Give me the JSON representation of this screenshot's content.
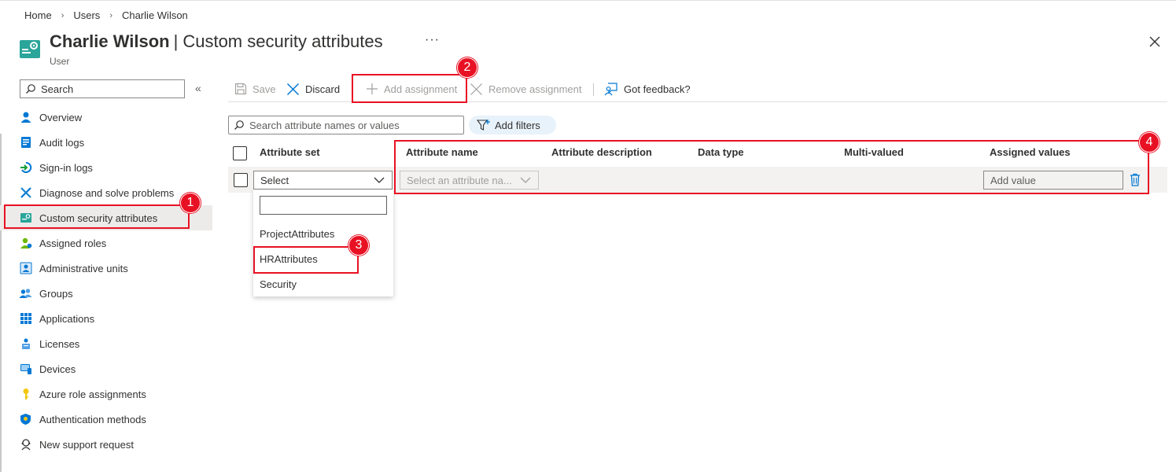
{
  "breadcrumb": [
    "Home",
    "Users",
    "Charlie Wilson"
  ],
  "header": {
    "title_name": "Charlie Wilson",
    "title_divider": "|",
    "title_section": "Custom security attributes",
    "more": "···",
    "subtitle": "User"
  },
  "sidebar": {
    "search_placeholder": "Search",
    "collapse": "«",
    "items": [
      {
        "label": "Overview",
        "icon": "user-icon"
      },
      {
        "label": "Audit logs",
        "icon": "audit-log-icon"
      },
      {
        "label": "Sign-in logs",
        "icon": "sign-in-icon"
      },
      {
        "label": "Diagnose and solve problems",
        "icon": "wrench-icon"
      },
      {
        "label": "Custom security attributes",
        "icon": "custom-attributes-icon",
        "selected": true
      },
      {
        "label": "Assigned roles",
        "icon": "assigned-roles-icon"
      },
      {
        "label": "Administrative units",
        "icon": "admin-units-icon"
      },
      {
        "label": "Groups",
        "icon": "groups-icon"
      },
      {
        "label": "Applications",
        "icon": "applications-icon"
      },
      {
        "label": "Licenses",
        "icon": "licenses-icon"
      },
      {
        "label": "Devices",
        "icon": "devices-icon"
      },
      {
        "label": "Azure role assignments",
        "icon": "key-icon"
      },
      {
        "label": "Authentication methods",
        "icon": "shield-icon"
      },
      {
        "label": "New support request",
        "icon": "support-icon"
      }
    ]
  },
  "toolbar": {
    "save": "Save",
    "discard": "Discard",
    "add_assignment": "Add assignment",
    "remove_assignment": "Remove assignment",
    "feedback": "Got feedback?"
  },
  "filters": {
    "search_placeholder": "Search attribute names or values",
    "add_filters": "Add filters"
  },
  "grid": {
    "columns": [
      "Attribute set",
      "Attribute name",
      "Attribute description",
      "Data type",
      "Multi-valued",
      "Assigned values"
    ],
    "row": {
      "attribute_set": "Select",
      "attribute_name_placeholder": "Select an attribute na...",
      "add_value_placeholder": "Add value"
    }
  },
  "dropdown": {
    "options": [
      "ProjectAttributes",
      "HRAttributes",
      "Security"
    ]
  },
  "annotations": [
    "1",
    "2",
    "3",
    "4"
  ],
  "colors": {
    "accent": "#0078d4",
    "callout_red": "#e81123",
    "selected_nav": "#edebe9",
    "teal_icon": "#2aa59a"
  }
}
